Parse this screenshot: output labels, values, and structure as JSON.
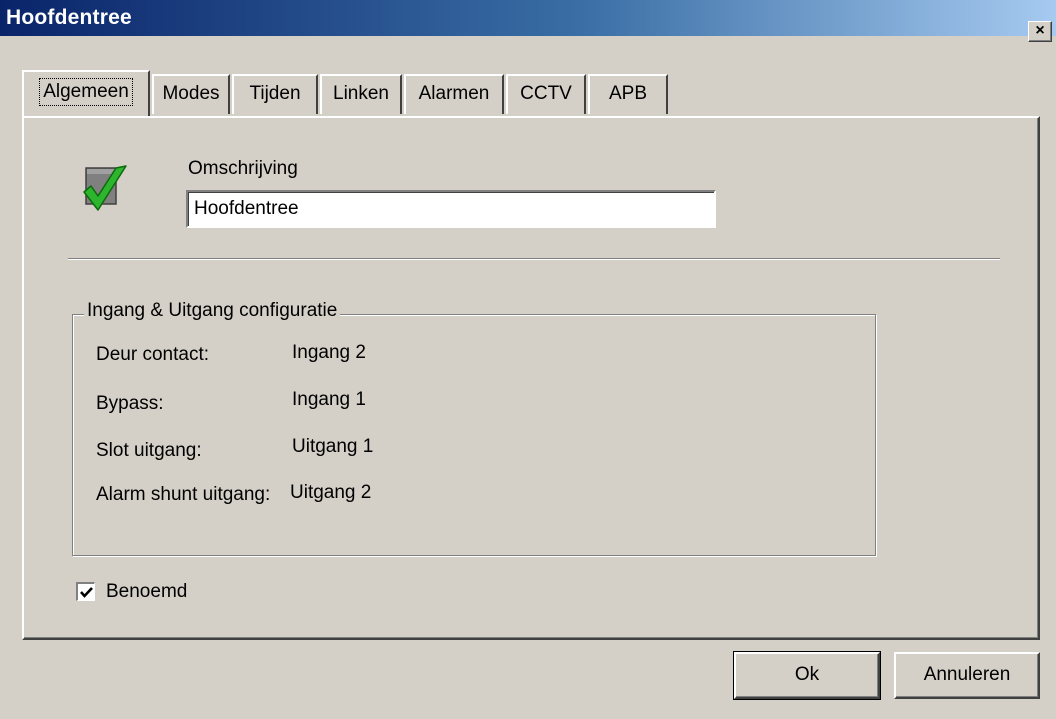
{
  "window": {
    "title": "Hoofdentree",
    "close_glyph": "×"
  },
  "tabs": [
    {
      "label": "Algemeen",
      "active": true
    },
    {
      "label": "Modes"
    },
    {
      "label": "Tijden"
    },
    {
      "label": "Linken"
    },
    {
      "label": "Alarmen"
    },
    {
      "label": "CCTV"
    },
    {
      "label": "APB"
    }
  ],
  "general": {
    "icon": "checked-box-icon",
    "description_label": "Omschrijving",
    "description_value": "Hoofdentree"
  },
  "io_config": {
    "legend": "Ingang & Uitgang configuratie",
    "rows": [
      {
        "label": "Deur contact:",
        "value": "Ingang 2"
      },
      {
        "label": "Bypass:",
        "value": "Ingang 1"
      },
      {
        "label": "Slot uitgang:",
        "value": "Uitgang 1"
      },
      {
        "label": "Alarm shunt uitgang:",
        "value": "Uitgang 2"
      }
    ]
  },
  "named": {
    "label": "Benoemd",
    "checked": true
  },
  "buttons": {
    "ok": "Ok",
    "cancel": "Annuleren"
  },
  "colors": {
    "titlebar_start": "#0a246a",
    "titlebar_end": "#a6caf0",
    "face": "#d4d0c8",
    "check_green": "#2db52d"
  }
}
